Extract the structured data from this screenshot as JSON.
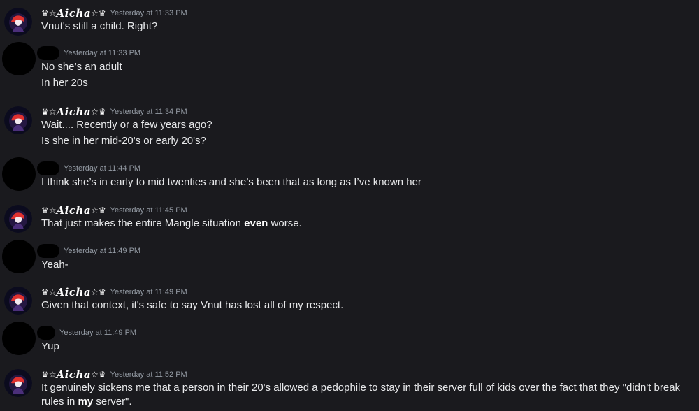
{
  "users": {
    "aicha": {
      "name": "Aicha",
      "prefix_glyphs": "♛☆",
      "suffix_glyphs": "☆♛"
    }
  },
  "messages": [
    {
      "user": "aicha",
      "time": "Yesterday at 11:33 PM",
      "lines": [
        "Vnut's still a child. Right?"
      ]
    },
    {
      "user": "hidden",
      "time": "Yesterday at 11:33 PM",
      "lines": [
        "No she’s an adult",
        "In her 20s"
      ]
    },
    {
      "user": "aicha",
      "time": "Yesterday at 11:34 PM",
      "lines": [
        "Wait.... Recently or a few years ago?",
        "Is she in her mid-20's or early 20's?"
      ]
    },
    {
      "user": "hidden",
      "time": "Yesterday at 11:44 PM",
      "lines": [
        "I think she’s in early to mid twenties and she’s been that as long as I’ve known her"
      ]
    },
    {
      "user": "aicha",
      "time": "Yesterday at 11:45 PM",
      "lines": [
        {
          "before": "That just makes the entire Mangle situation ",
          "bold": "even",
          "after": " worse."
        }
      ]
    },
    {
      "user": "hidden",
      "time": "Yesterday at 11:49 PM",
      "lines": [
        "Yeah-"
      ]
    },
    {
      "user": "aicha",
      "time": "Yesterday at 11:49 PM",
      "lines": [
        "Given that context, it's safe to say Vnut has lost all of my respect."
      ]
    },
    {
      "user": "hidden",
      "time": "Yesterday at 11:49 PM",
      "lines": [
        "Yup"
      ]
    },
    {
      "user": "aicha",
      "time": "Yesterday at 11:52 PM",
      "lines": [
        {
          "before": "It genuinely sickens me that a person in their 20's allowed a pedophile to stay in their server full of kids over the fact that they \"didn't break rules in ",
          "bold": "my",
          "after": " server\"."
        }
      ]
    }
  ],
  "colors": {
    "background": "#1a1a1e",
    "text": "#e8e9eb",
    "timestamp": "#949ba4",
    "avatar_bg": "#0b0b1e",
    "avatar_accent": "#e0312f"
  }
}
